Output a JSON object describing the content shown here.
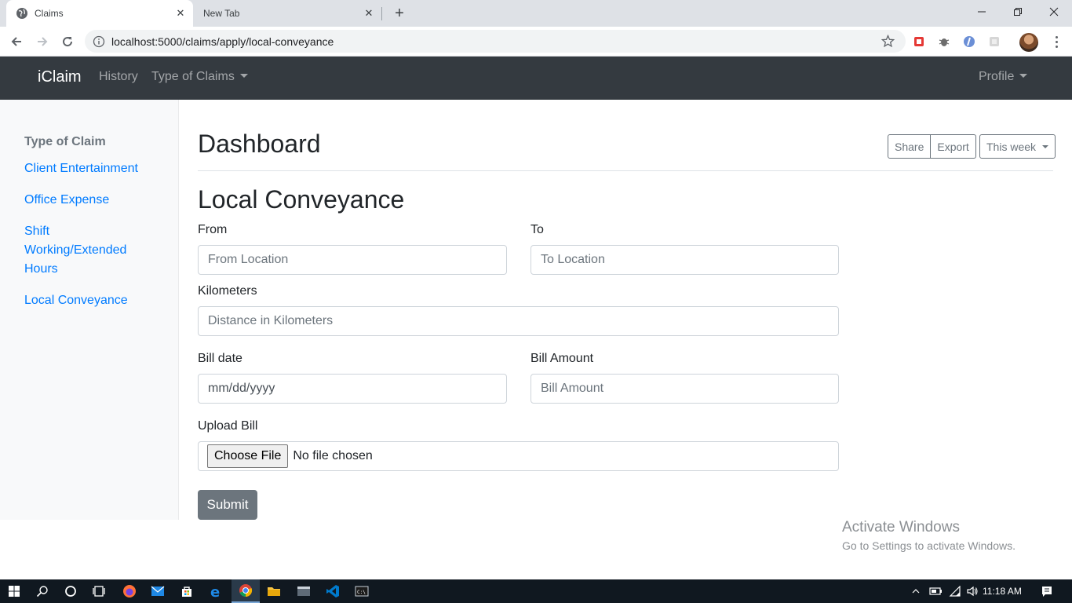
{
  "browser": {
    "tabs": [
      {
        "title": "Claims",
        "active": true
      },
      {
        "title": "New Tab",
        "active": false
      }
    ],
    "url": "localhost:5000/claims/apply/local-conveyance",
    "icons": [
      "globe-icon",
      "close-icon",
      "plus-icon",
      "back-icon",
      "forward-icon",
      "reload-icon",
      "info-icon",
      "star-icon",
      "menu-icon"
    ]
  },
  "navbar": {
    "brand": "iClaim",
    "history": "History",
    "type_of_claims": "Type of Claims",
    "profile": "Profile",
    "bg_color": "#343a40"
  },
  "sidebar": {
    "heading": "Type of Claim",
    "items": [
      {
        "label": "Client Entertainment"
      },
      {
        "label": "Office Expense"
      },
      {
        "label": "Shift Working/Extended Hours"
      },
      {
        "label": "Local Conveyance"
      }
    ],
    "link_color": "#007bff"
  },
  "main": {
    "title": "Dashboard",
    "share": "Share",
    "export": "Export",
    "period": "This week"
  },
  "form": {
    "title": "Local Conveyance",
    "from_label": "From",
    "from_placeholder": "From Location",
    "to_label": "To",
    "to_placeholder": "To Location",
    "km_label": "Kilometers",
    "km_placeholder": "Distance in Kilometers",
    "bill_date_label": "Bill date",
    "bill_date_value": "mm/dd/yyyy",
    "bill_amount_label": "Bill Amount",
    "bill_amount_placeholder": "Bill Amount",
    "upload_label": "Upload Bill",
    "choose_file": "Choose File",
    "no_file": "No file chosen",
    "submit": "Submit"
  },
  "watermark": {
    "line1": "Activate Windows",
    "line2": "Go to Settings to activate Windows."
  },
  "taskbar": {
    "time": "11:18 AM"
  }
}
